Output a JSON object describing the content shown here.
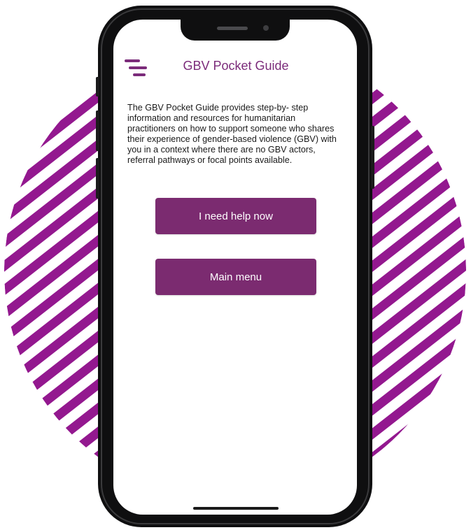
{
  "app": {
    "title": "GBV Pocket Guide",
    "intro": "The GBV Pocket Guide provides step-by- step information and resources for humanitarian practitioners on how to support someone who shares their experience of gender-based violence (GBV) with you in a context where there are no GBV actors, referral pathways or focal points available."
  },
  "buttons": {
    "help_label": "I need help now",
    "menu_label": "Main menu"
  },
  "icons": {
    "menu": "menu-icon"
  },
  "colors": {
    "brand": "#7b2b7a",
    "button": "#7b2b70",
    "stripe": "#93188f",
    "phone": "#0f0f10"
  }
}
